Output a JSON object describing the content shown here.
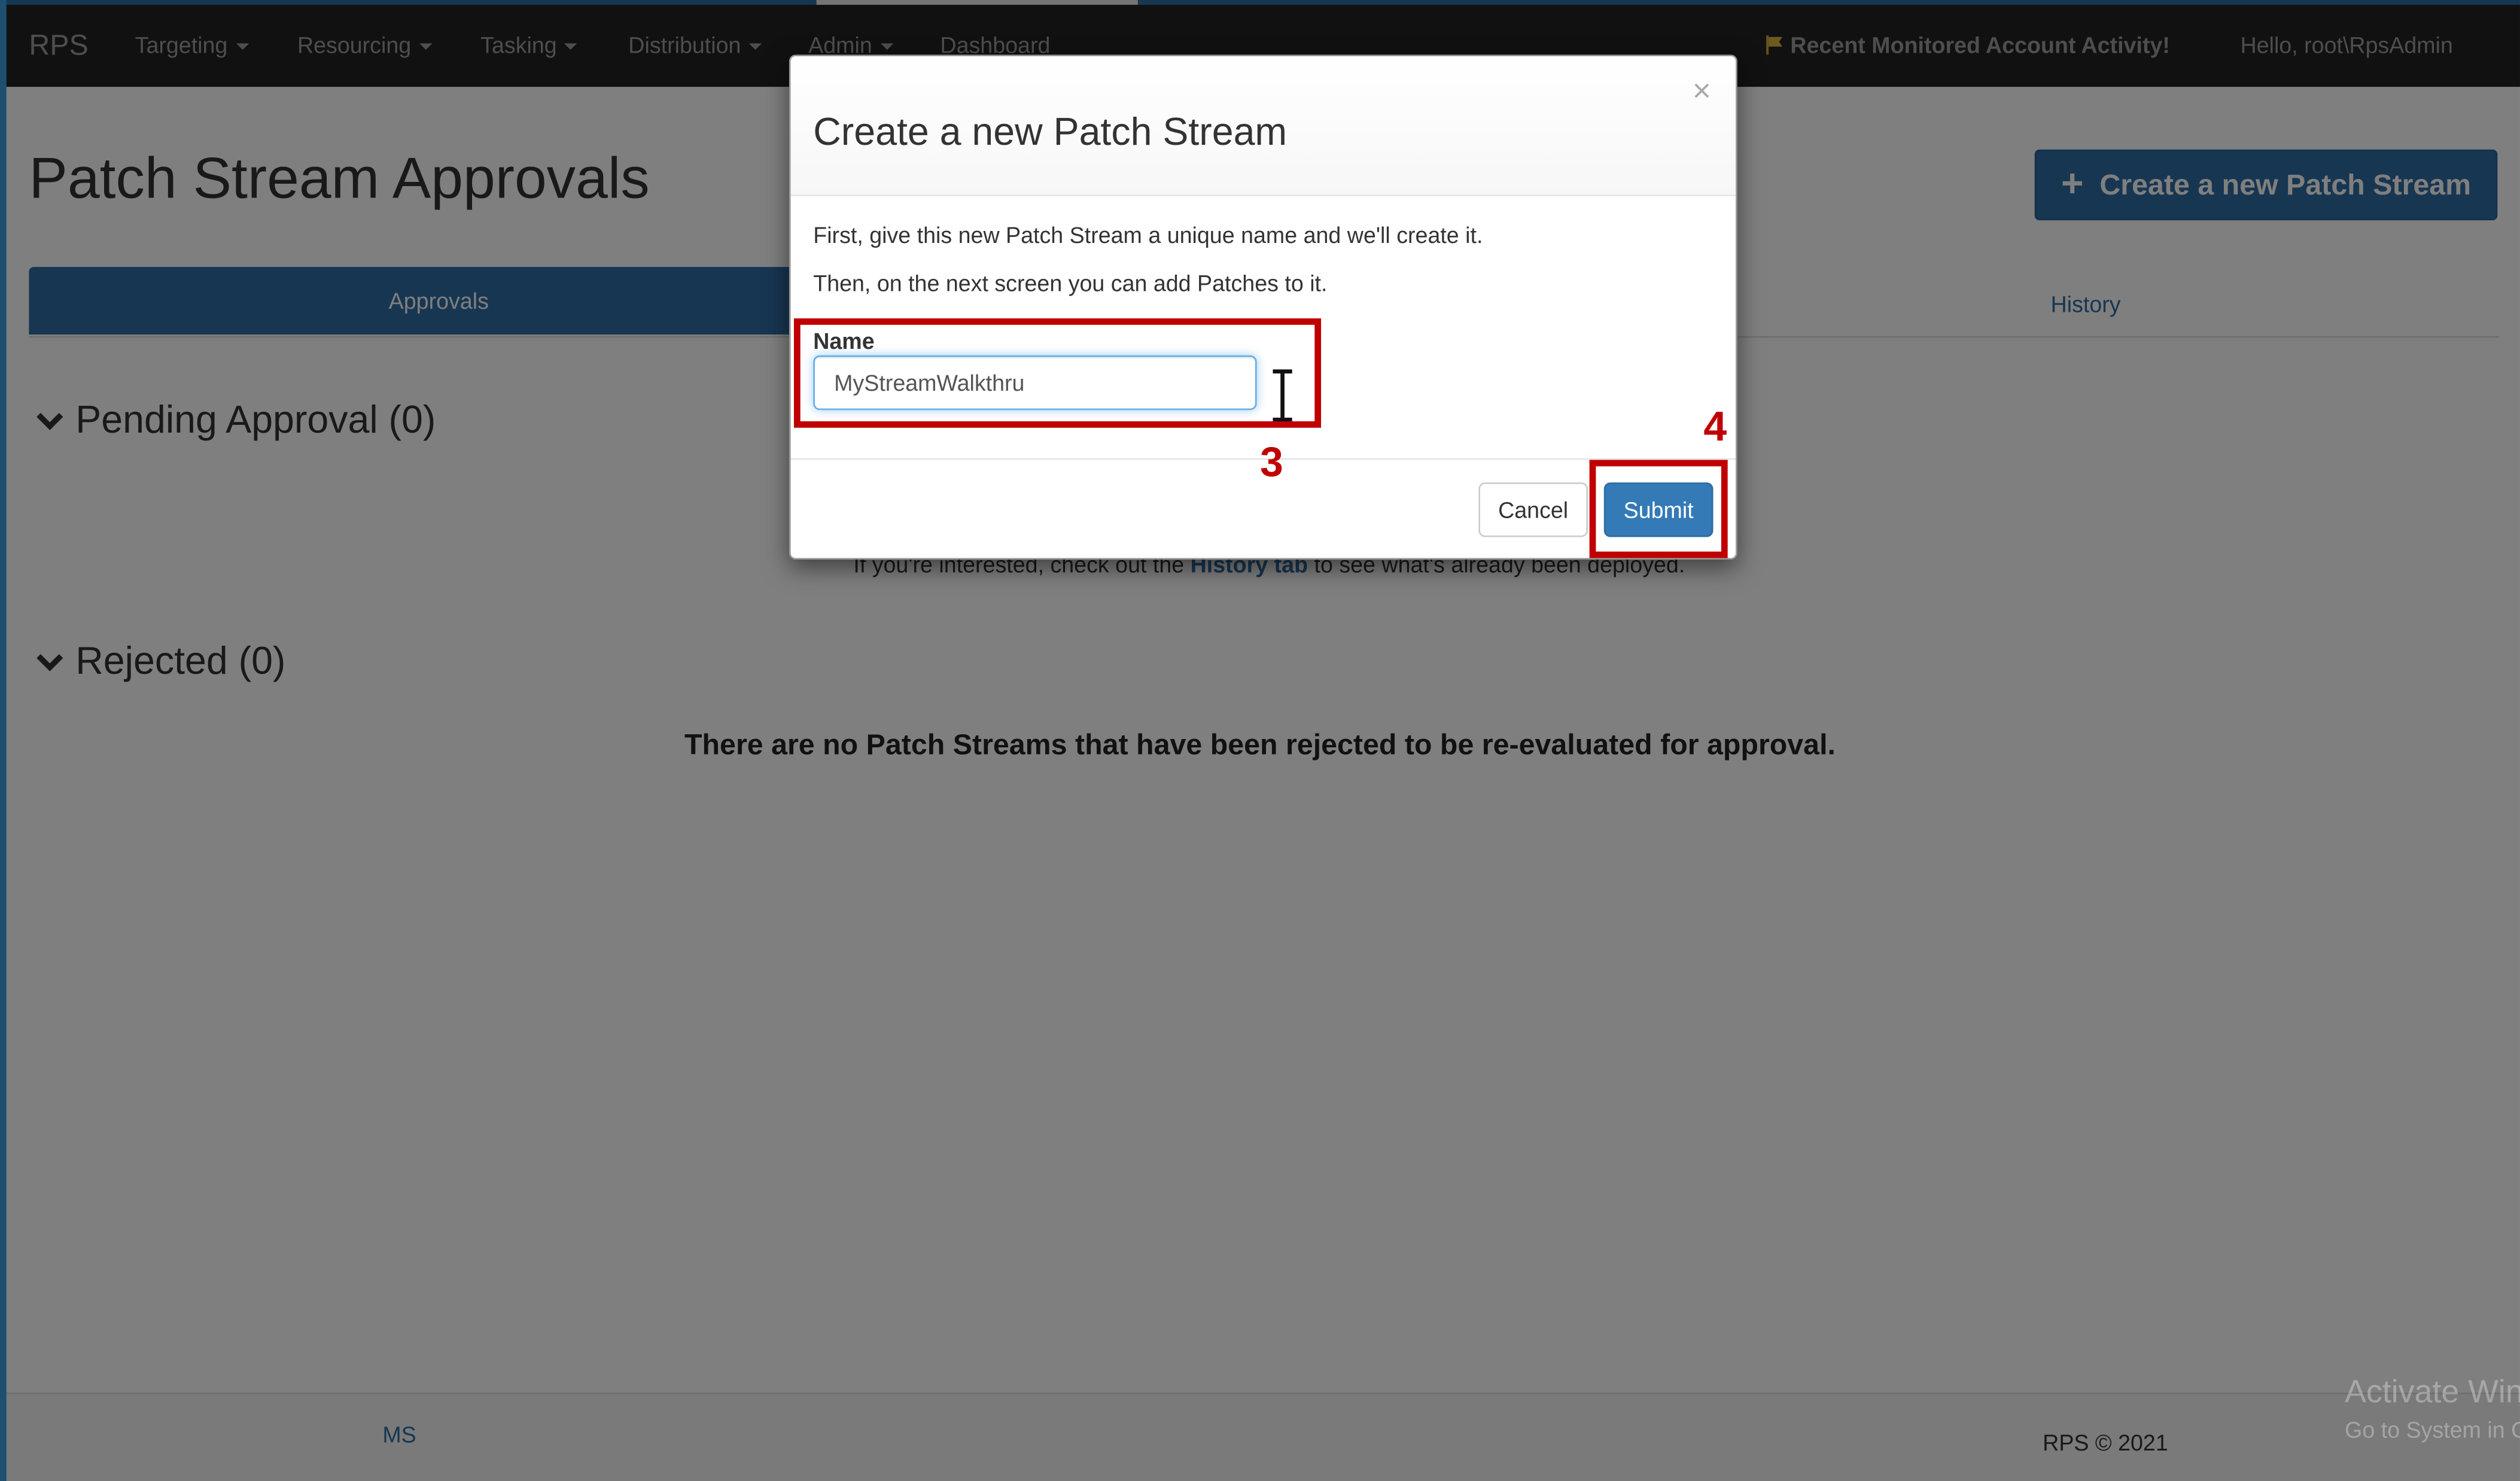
{
  "navbar": {
    "brand": "RPS",
    "menus": [
      "Targeting",
      "Resourcing",
      "Tasking",
      "Distribution",
      "Admin"
    ],
    "dashboard": "Dashboard",
    "alert": "Recent Monitored Account Activity!",
    "greeting": "Hello, root\\RpsAdmin"
  },
  "page": {
    "title": "Patch Stream Approvals",
    "create_button": "Create a new Patch Stream",
    "tabs": {
      "approvals": "Approvals",
      "history": "History"
    },
    "pending_heading": "Pending Approval (0)",
    "pending_note": {
      "before": "If you're interested, check out the ",
      "link": "History tab",
      "after": " to see what's already been deployed."
    },
    "rejected_heading": "Rejected (0)",
    "rejected_empty": "There are no Patch Streams that have been rejected to be re-evaluated for approval."
  },
  "footer": {
    "left_link": "MS",
    "copyright": "RPS © 2021"
  },
  "watermark": {
    "line1": "Activate Windows",
    "line2": "Go to System in Control Panel to activate Windows."
  },
  "modal": {
    "title": "Create a new Patch Stream",
    "close_glyph": "×",
    "intro_line1": "First, give this new Patch Stream a unique name and we'll create it.",
    "intro_line2": "Then, on the next screen you can add Patches to it.",
    "name_label": "Name",
    "name_value": "MyStreamWalkthru",
    "cancel_label": "Cancel",
    "submit_label": "Submit"
  },
  "callouts": {
    "step_name": "3",
    "step_submit": "4"
  },
  "colors": {
    "primary": "#337ab7",
    "navbar": "#222222",
    "callout": "#c00000",
    "alert_text": "#c7b16a"
  },
  "icons": [
    "flag-icon",
    "plus-icon",
    "chevron-down-icon",
    "close-icon",
    "text-cursor-icon"
  ]
}
